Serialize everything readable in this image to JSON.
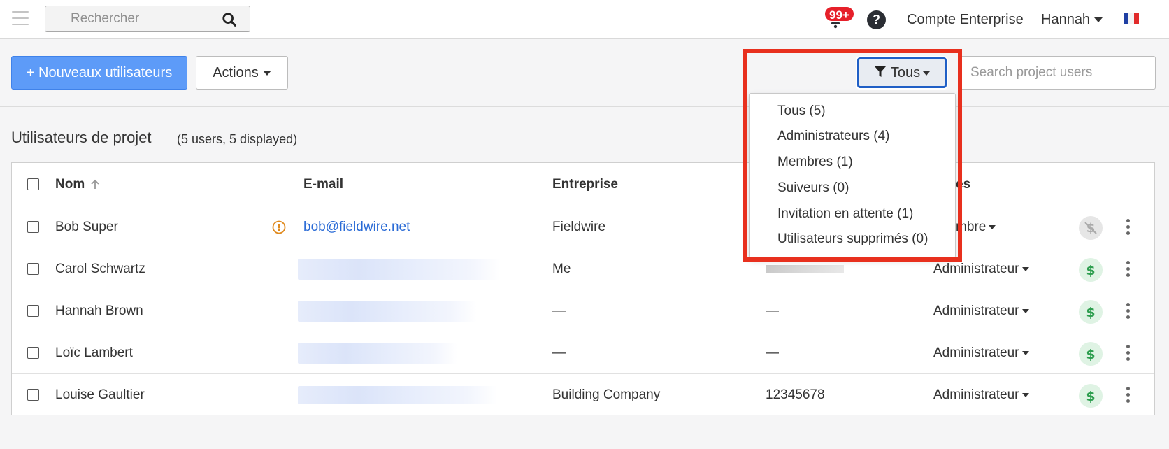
{
  "topbar": {
    "search_placeholder": "Rechercher",
    "notifications_badge": "99+",
    "help_label": "?",
    "account_label": "Compte Enterprise",
    "user_name": "Hannah",
    "icons": [
      "hamburger-icon",
      "search-icon",
      "bell-icon",
      "help-icon",
      "flag-fr-icon"
    ]
  },
  "toolbar": {
    "new_users_label": "+ Nouveaux utilisateurs",
    "actions_label": "Actions",
    "filter_label": "Tous",
    "project_search_placeholder": "Search project users"
  },
  "section": {
    "title": "Utilisateurs de projet",
    "count": "(5 users, 5 displayed)"
  },
  "table": {
    "headers": {
      "name": "Nom",
      "email": "E-mail",
      "company": "Entreprise",
      "role_partial": "es"
    },
    "rows": [
      {
        "name": "Bob Super",
        "email": "bob@fieldwire.net",
        "company": "Fieldwire",
        "phone": "",
        "role": "mbre",
        "warning": true,
        "billing": "inactive"
      },
      {
        "name": "Carol Schwartz",
        "email": "",
        "company": "Me",
        "phone": "",
        "role": "Administrateur",
        "warning": false,
        "billing": "active"
      },
      {
        "name": "Hannah Brown",
        "email": "",
        "company": "—",
        "phone": "—",
        "role": "Administrateur",
        "warning": false,
        "billing": "active"
      },
      {
        "name": "Loïc Lambert",
        "email": "",
        "company": "—",
        "phone": "—",
        "role": "Administrateur",
        "warning": false,
        "billing": "active"
      },
      {
        "name": "Louise Gaultier",
        "email": "",
        "company": "Building Company",
        "phone": "12345678",
        "role": "Administrateur",
        "warning": false,
        "billing": "active"
      }
    ]
  },
  "filter_dropdown": {
    "items": [
      "Tous (5)",
      "Administrateurs (4)",
      "Membres (1)",
      "Suiveurs (0)",
      "Invitation en attente (1)",
      "Utilisateurs supprimés (0)"
    ]
  },
  "colors": {
    "primary_button": "#5d9bf8",
    "link": "#2a6bd6",
    "highlight_border": "#e8301e",
    "badge": "#e6202a",
    "billing_active": "#2e9e4f",
    "warning": "#e08a1e"
  }
}
